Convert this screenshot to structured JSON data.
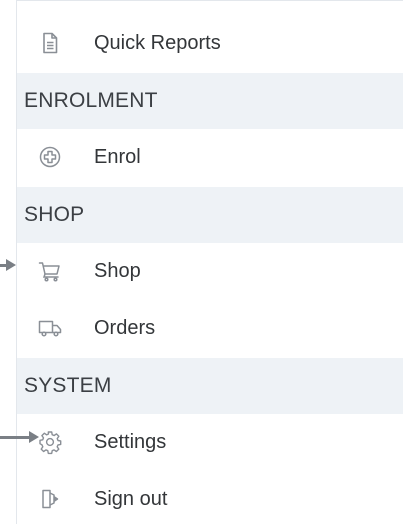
{
  "menu": {
    "quick_reports": {
      "label": "Quick Reports",
      "icon": "document-icon"
    },
    "enrolment_header": "ENROLMENT",
    "enrol": {
      "label": "Enrol",
      "icon": "plus-circle-icon"
    },
    "shop_header": "SHOP",
    "shop": {
      "label": "Shop",
      "icon": "cart-icon"
    },
    "orders": {
      "label": "Orders",
      "icon": "truck-icon"
    },
    "system_header": "SYSTEM",
    "settings": {
      "label": "Settings",
      "icon": "gear-icon"
    },
    "sign_out": {
      "label": "Sign out",
      "icon": "sign-out-icon"
    }
  },
  "colors": {
    "section_bg": "#eef2f6",
    "icon": "#8a8f96",
    "text": "#333639",
    "arrow": "#7a7f85"
  }
}
